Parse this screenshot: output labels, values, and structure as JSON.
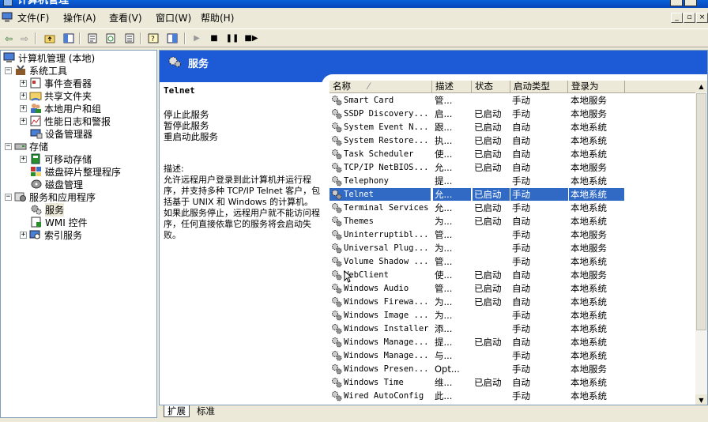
{
  "window": {
    "title": "计算机管理"
  },
  "menu": {
    "items": [
      "文件(F)",
      "操作(A)",
      "查看(V)",
      "窗口(W)",
      "帮助(H)"
    ]
  },
  "tree": {
    "root": "计算机管理 (本地)",
    "system_tools": "系统工具",
    "event_viewer": "事件查看器",
    "shared_folders": "共享文件夹",
    "local_users": "本地用户和组",
    "perf_logs": "性能日志和警报",
    "device_manager": "设备管理器",
    "storage": "存储",
    "removable_storage": "可移动存储",
    "defrag": "磁盘碎片整理程序",
    "disk_mgmt": "磁盘管理",
    "services_apps": "服务和应用程序",
    "services": "服务",
    "wmi": "WMI 控件",
    "indexing": "索引服务"
  },
  "pane": {
    "header": "服务",
    "service_name": "Telnet",
    "link_stop_a": "停止",
    "link_stop_b": "此服务",
    "link_pause_a": "暂停",
    "link_pause_b": "此服务",
    "link_restart_a": "重启动",
    "link_restart_b": "此服务",
    "description": "描述:\n允许远程用户登录到此计算机并运行程序，并支持多种 TCP/IP Telnet 客户，包括基于 UNIX 和 Windows 的计算机。如果此服务停止，远程用户就不能访问程序，任何直接依靠它的服务将会启动失败。"
  },
  "columns": {
    "name": "名称",
    "desc": "描述",
    "status": "状态",
    "start": "启动类型",
    "logon": "登录为"
  },
  "services": [
    {
      "name": "Smart Card",
      "desc": "管...",
      "status": "",
      "start": "手动",
      "logon": "本地服务"
    },
    {
      "name": "SSDP Discovery...",
      "desc": "启...",
      "status": "已启动",
      "start": "手动",
      "logon": "本地服务"
    },
    {
      "name": "System Event N...",
      "desc": "跟...",
      "status": "已启动",
      "start": "自动",
      "logon": "本地系统"
    },
    {
      "name": "System Restore...",
      "desc": "执...",
      "status": "已启动",
      "start": "自动",
      "logon": "本地系统"
    },
    {
      "name": "Task Scheduler",
      "desc": "使...",
      "status": "已启动",
      "start": "自动",
      "logon": "本地系统"
    },
    {
      "name": "TCP/IP NetBIOS...",
      "desc": "允...",
      "status": "已启动",
      "start": "自动",
      "logon": "本地服务"
    },
    {
      "name": "Telephony",
      "desc": "提...",
      "status": "",
      "start": "手动",
      "logon": "本地系统"
    },
    {
      "name": "Telnet",
      "desc": "允...",
      "status": "已启动",
      "start": "手动",
      "logon": "本地系统"
    },
    {
      "name": "Terminal Services",
      "desc": "允...",
      "status": "已启动",
      "start": "手动",
      "logon": "本地系统"
    },
    {
      "name": "Themes",
      "desc": "为...",
      "status": "已启动",
      "start": "自动",
      "logon": "本地系统"
    },
    {
      "name": "Uninterruptibl...",
      "desc": "管...",
      "status": "",
      "start": "手动",
      "logon": "本地服务"
    },
    {
      "name": "Universal Plug...",
      "desc": "为...",
      "status": "",
      "start": "手动",
      "logon": "本地服务"
    },
    {
      "name": "Volume Shadow ...",
      "desc": "管...",
      "status": "",
      "start": "手动",
      "logon": "本地系统"
    },
    {
      "name": "WebClient",
      "desc": "使...",
      "status": "已启动",
      "start": "自动",
      "logon": "本地服务"
    },
    {
      "name": "Windows Audio",
      "desc": "管...",
      "status": "已启动",
      "start": "自动",
      "logon": "本地系统"
    },
    {
      "name": "Windows Firewa...",
      "desc": "为...",
      "status": "已启动",
      "start": "自动",
      "logon": "本地系统"
    },
    {
      "name": "Windows Image ...",
      "desc": "为...",
      "status": "",
      "start": "手动",
      "logon": "本地系统"
    },
    {
      "name": "Windows Installer",
      "desc": "添...",
      "status": "",
      "start": "手动",
      "logon": "本地系统"
    },
    {
      "name": "Windows Manage...",
      "desc": "提...",
      "status": "已启动",
      "start": "自动",
      "logon": "本地系统"
    },
    {
      "name": "Windows Manage...",
      "desc": "与...",
      "status": "",
      "start": "手动",
      "logon": "本地系统"
    },
    {
      "name": "Windows Presen...",
      "desc": "Opt...",
      "status": "",
      "start": "手动",
      "logon": "本地服务"
    },
    {
      "name": "Windows Time",
      "desc": "维...",
      "status": "已启动",
      "start": "自动",
      "logon": "本地系统"
    },
    {
      "name": "Wired AutoConfig",
      "desc": "此...",
      "status": "",
      "start": "手动",
      "logon": "本地系统"
    }
  ],
  "selected_service_index": 7,
  "tabs": [
    "扩展",
    "标准"
  ],
  "colors": {
    "header_blue": "#1c5ad6",
    "selection": "#316ac5",
    "link": "#0000ff"
  }
}
